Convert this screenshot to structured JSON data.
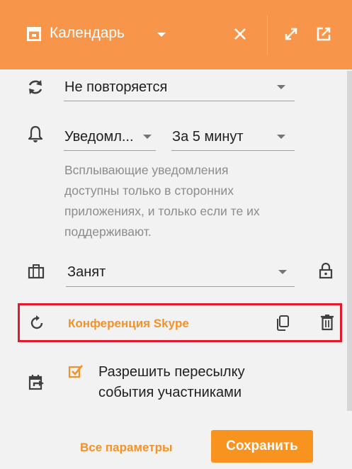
{
  "header": {
    "title": "Календарь",
    "accent_color": "#f7964a",
    "icons": [
      "calendar-icon",
      "dropdown-icon",
      "close-icon",
      "expand-icon",
      "open-external-icon"
    ]
  },
  "repeat": {
    "icon": "repeat-icon",
    "value": "Не повторяется"
  },
  "notification": {
    "icon": "bell-icon",
    "type_value": "Уведомл...",
    "time_value": "За 5 минут",
    "hint_lines": [
      "Всплывающие уведомления",
      "доступны только в сторонних",
      "приложениях, и только если те их",
      "поддерживают."
    ]
  },
  "busy": {
    "icon": "briefcase-icon",
    "value": "Занят",
    "lock_icon": "lock-icon"
  },
  "conference": {
    "icon": "refresh-icon",
    "label": "Конференция Skype",
    "copy_icon": "copy-icon",
    "delete_icon": "trash-icon",
    "highlight_color": "#e01b2d"
  },
  "forwarding": {
    "icon": "forward-calendar-icon",
    "checkbox_checked": true,
    "label_line1": "Разрешить пересылку",
    "label_line2": "события участниками"
  },
  "footer": {
    "all_params_label": "Все параметры",
    "save_label": "Сохранить"
  }
}
